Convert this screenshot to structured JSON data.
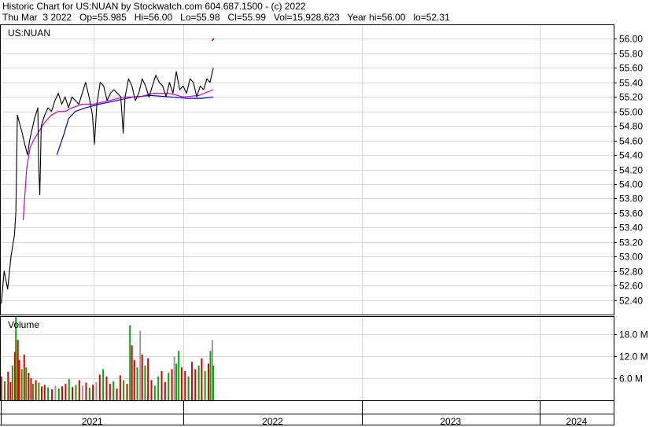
{
  "header": {
    "line1": "Historic Chart for US:NUAN by Stockwatch.com 604.687.1500 - (c) 2022",
    "line2": "Thu Mar  3 2022   Op=55.985   Hi=56.00   Lo=55.98   Cl=55.99   Vol=15,928,623   Year hi=56.00   lo=52.31"
  },
  "chart_data": {
    "type": "line",
    "symbol": "US:NUAN",
    "price_axis": {
      "ylim": [
        52.2,
        56.2
      ],
      "ticks": [
        "56.00",
        "55.80",
        "55.60",
        "55.40",
        "55.20",
        "55.00",
        "54.80",
        "54.60",
        "54.40",
        "54.20",
        "54.00",
        "53.80",
        "53.60",
        "53.40",
        "53.20",
        "53.00",
        "52.80",
        "52.60",
        "52.40"
      ],
      "grid": true
    },
    "volume_panel": {
      "label": "Volume",
      "ylim": [
        0,
        23
      ],
      "ticks": [
        "18.0 M",
        "12.0 M",
        "6.0 M"
      ],
      "unit": "M"
    },
    "x_axis": {
      "range": [
        "2020-12-22",
        "2024-06-01"
      ],
      "labels": [
        "2021",
        "2022",
        "2023",
        "2024"
      ],
      "year_starts": [
        "2021-01-01",
        "2022-01-01",
        "2023-01-01",
        "2024-01-01",
        "2024-06-01"
      ],
      "grid_dates": [
        "2021-07-01",
        "2023-01-01",
        "2024-01-01"
      ]
    },
    "colors": {
      "price": "#000000",
      "ma_short": "#cc00cc",
      "ma_long": "#0000cc",
      "vol_up": "#00aa00",
      "vol_down": "#dd0000",
      "vol_flat": "#999999",
      "last_marker": "#990000"
    },
    "last_point": {
      "date": "2022-03-03",
      "value": 55.99
    },
    "series": [
      {
        "key": "close",
        "points": [
          [
            "2020-12-23",
            52.35
          ],
          [
            "2020-12-29",
            52.8
          ],
          [
            "2021-01-05",
            52.55
          ],
          [
            "2021-01-12",
            53.0
          ],
          [
            "2021-01-19",
            53.3
          ],
          [
            "2021-01-22",
            53.62
          ],
          [
            "2021-01-25",
            54.95
          ],
          [
            "2021-01-29",
            54.85
          ],
          [
            "2021-02-04",
            54.7
          ],
          [
            "2021-02-09",
            54.55
          ],
          [
            "2021-02-15",
            54.4
          ],
          [
            "2021-02-19",
            54.6
          ],
          [
            "2021-02-24",
            54.75
          ],
          [
            "2021-03-01",
            54.9
          ],
          [
            "2021-03-08",
            55.05
          ],
          [
            "2021-03-10",
            54.2
          ],
          [
            "2021-03-12",
            53.85
          ],
          [
            "2021-03-15",
            54.8
          ],
          [
            "2021-03-22",
            54.95
          ],
          [
            "2021-03-29",
            55.05
          ],
          [
            "2021-04-05",
            55.0
          ],
          [
            "2021-04-12",
            55.15
          ],
          [
            "2021-04-19",
            55.25
          ],
          [
            "2021-04-26",
            55.1
          ],
          [
            "2021-05-03",
            55.2
          ],
          [
            "2021-05-10",
            55.05
          ],
          [
            "2021-05-17",
            55.2
          ],
          [
            "2021-05-24",
            55.15
          ],
          [
            "2021-05-31",
            55.1
          ],
          [
            "2021-06-07",
            55.25
          ],
          [
            "2021-06-14",
            55.4
          ],
          [
            "2021-06-21",
            55.2
          ],
          [
            "2021-06-28",
            54.95
          ],
          [
            "2021-07-02",
            54.55
          ],
          [
            "2021-07-07",
            55.1
          ],
          [
            "2021-07-14",
            55.4
          ],
          [
            "2021-07-21",
            55.35
          ],
          [
            "2021-07-28",
            55.15
          ],
          [
            "2021-08-04",
            55.25
          ],
          [
            "2021-08-11",
            55.3
          ],
          [
            "2021-08-18",
            55.25
          ],
          [
            "2021-08-25",
            55.2
          ],
          [
            "2021-08-30",
            54.7
          ],
          [
            "2021-09-03",
            55.2
          ],
          [
            "2021-09-10",
            55.45
          ],
          [
            "2021-09-17",
            55.35
          ],
          [
            "2021-09-24",
            55.15
          ],
          [
            "2021-10-01",
            55.25
          ],
          [
            "2021-10-08",
            55.45
          ],
          [
            "2021-10-15",
            55.35
          ],
          [
            "2021-10-22",
            55.2
          ],
          [
            "2021-10-29",
            55.35
          ],
          [
            "2021-11-05",
            55.5
          ],
          [
            "2021-11-12",
            55.4
          ],
          [
            "2021-11-19",
            55.35
          ],
          [
            "2021-11-26",
            55.2
          ],
          [
            "2021-12-03",
            55.4
          ],
          [
            "2021-12-10",
            55.25
          ],
          [
            "2021-12-17",
            55.55
          ],
          [
            "2021-12-24",
            55.3
          ],
          [
            "2021-12-31",
            55.35
          ],
          [
            "2022-01-07",
            55.25
          ],
          [
            "2022-01-14",
            55.45
          ],
          [
            "2022-01-21",
            55.4
          ],
          [
            "2022-01-28",
            55.2
          ],
          [
            "2022-02-04",
            55.35
          ],
          [
            "2022-02-11",
            55.3
          ],
          [
            "2022-02-18",
            55.45
          ],
          [
            "2022-02-24",
            55.4
          ],
          [
            "2022-03-01",
            55.55
          ],
          [
            "2022-03-03",
            55.6
          ]
        ]
      },
      {
        "key": "ma_short",
        "points": [
          [
            "2021-02-06",
            53.5
          ],
          [
            "2021-02-13",
            54.2
          ],
          [
            "2021-02-20",
            54.5
          ],
          [
            "2021-02-27",
            54.6
          ],
          [
            "2021-03-08",
            54.7
          ],
          [
            "2021-03-22",
            54.85
          ],
          [
            "2021-04-05",
            54.95
          ],
          [
            "2021-04-19",
            55.0
          ],
          [
            "2021-05-03",
            55.0
          ],
          [
            "2021-05-17",
            55.05
          ],
          [
            "2021-06-07",
            55.1
          ],
          [
            "2021-07-01",
            55.1
          ],
          [
            "2021-08-01",
            55.15
          ],
          [
            "2021-09-01",
            55.2
          ],
          [
            "2021-10-01",
            55.2
          ],
          [
            "2021-11-01",
            55.25
          ],
          [
            "2021-12-01",
            55.25
          ],
          [
            "2022-01-01",
            55.2
          ],
          [
            "2022-02-01",
            55.22
          ],
          [
            "2022-03-03",
            55.3
          ]
        ]
      },
      {
        "key": "ma_long",
        "points": [
          [
            "2021-04-16",
            54.4
          ],
          [
            "2021-05-01",
            54.7
          ],
          [
            "2021-05-10",
            54.9
          ],
          [
            "2021-05-24",
            55.0
          ],
          [
            "2021-06-14",
            55.05
          ],
          [
            "2021-07-12",
            55.1
          ],
          [
            "2021-08-16",
            55.15
          ],
          [
            "2021-09-20",
            55.2
          ],
          [
            "2021-10-25",
            55.22
          ],
          [
            "2021-12-06",
            55.2
          ],
          [
            "2022-01-10",
            55.18
          ],
          [
            "2022-02-07",
            55.18
          ],
          [
            "2022-03-03",
            55.2
          ]
        ]
      },
      {
        "key": "volume",
        "points": [
          [
            "2020-12-23",
            6.5,
            "d"
          ],
          [
            "2020-12-30",
            5.2,
            "u"
          ],
          [
            "2021-01-06",
            7.8,
            "d"
          ],
          [
            "2021-01-11",
            5.0,
            "d"
          ],
          [
            "2021-01-15",
            9.5,
            "u"
          ],
          [
            "2021-01-20",
            13.2,
            "d"
          ],
          [
            "2021-01-22",
            23.0,
            "u"
          ],
          [
            "2021-01-26",
            16.5,
            "d"
          ],
          [
            "2021-01-29",
            11.0,
            "d"
          ],
          [
            "2021-02-03",
            8.5,
            "u"
          ],
          [
            "2021-02-08",
            12.5,
            "d"
          ],
          [
            "2021-02-12",
            9.0,
            "u"
          ],
          [
            "2021-02-17",
            7.5,
            "d"
          ],
          [
            "2021-02-22",
            6.0,
            "d"
          ],
          [
            "2021-02-26",
            4.5,
            "u"
          ],
          [
            "2021-03-04",
            5.5,
            "d"
          ],
          [
            "2021-03-10",
            4.8,
            "u"
          ],
          [
            "2021-03-16",
            3.8,
            "d"
          ],
          [
            "2021-03-22",
            4.2,
            "d"
          ],
          [
            "2021-03-29",
            3.5,
            "u"
          ],
          [
            "2021-04-06",
            3.0,
            "d"
          ],
          [
            "2021-04-13",
            4.0,
            "f"
          ],
          [
            "2021-04-20",
            3.2,
            "u"
          ],
          [
            "2021-04-27",
            3.8,
            "d"
          ],
          [
            "2021-05-04",
            4.5,
            "d"
          ],
          [
            "2021-05-11",
            5.8,
            "u"
          ],
          [
            "2021-05-18",
            3.6,
            "d"
          ],
          [
            "2021-05-25",
            4.2,
            "u"
          ],
          [
            "2021-06-01",
            5.5,
            "d"
          ],
          [
            "2021-06-08",
            4.0,
            "f"
          ],
          [
            "2021-06-15",
            4.8,
            "d"
          ],
          [
            "2021-06-22",
            3.4,
            "u"
          ],
          [
            "2021-06-29",
            4.2,
            "d"
          ],
          [
            "2021-07-06",
            5.0,
            "f"
          ],
          [
            "2021-07-13",
            7.0,
            "d"
          ],
          [
            "2021-07-20",
            8.5,
            "u"
          ],
          [
            "2021-07-27",
            6.5,
            "d"
          ],
          [
            "2021-08-03",
            4.5,
            "d"
          ],
          [
            "2021-08-10",
            5.2,
            "u"
          ],
          [
            "2021-08-17",
            3.2,
            "d"
          ],
          [
            "2021-08-24",
            6.8,
            "d"
          ],
          [
            "2021-08-31",
            5.5,
            "u"
          ],
          [
            "2021-09-07",
            4.5,
            "d"
          ],
          [
            "2021-09-13",
            20.5,
            "u"
          ],
          [
            "2021-09-17",
            15.0,
            "d"
          ],
          [
            "2021-09-22",
            11.0,
            "d"
          ],
          [
            "2021-09-28",
            9.0,
            "u"
          ],
          [
            "2021-10-04",
            19.0,
            "f"
          ],
          [
            "2021-10-08",
            12.5,
            "d"
          ],
          [
            "2021-10-14",
            9.5,
            "u"
          ],
          [
            "2021-10-20",
            11.5,
            "d"
          ],
          [
            "2021-10-27",
            5.5,
            "d"
          ],
          [
            "2021-11-03",
            4.0,
            "u"
          ],
          [
            "2021-11-10",
            6.5,
            "u"
          ],
          [
            "2021-11-17",
            8.0,
            "d"
          ],
          [
            "2021-11-24",
            5.0,
            "d"
          ],
          [
            "2021-12-01",
            7.5,
            "u"
          ],
          [
            "2021-12-08",
            8.5,
            "d"
          ],
          [
            "2021-12-13",
            12.0,
            "f"
          ],
          [
            "2021-12-17",
            10.0,
            "u"
          ],
          [
            "2021-12-22",
            13.5,
            "u"
          ],
          [
            "2021-12-28",
            9.0,
            "d"
          ],
          [
            "2022-01-04",
            8.0,
            "d"
          ],
          [
            "2022-01-11",
            6.5,
            "u"
          ],
          [
            "2022-01-18",
            10.5,
            "d"
          ],
          [
            "2022-01-25",
            8.5,
            "d"
          ],
          [
            "2022-02-01",
            9.5,
            "u"
          ],
          [
            "2022-02-07",
            11.5,
            "d"
          ],
          [
            "2022-02-14",
            8.0,
            "u"
          ],
          [
            "2022-02-21",
            10.0,
            "d"
          ],
          [
            "2022-02-25",
            13.5,
            "u"
          ],
          [
            "2022-03-01",
            16.5,
            "f"
          ],
          [
            "2022-03-03",
            9.5,
            "u"
          ]
        ]
      }
    ]
  }
}
